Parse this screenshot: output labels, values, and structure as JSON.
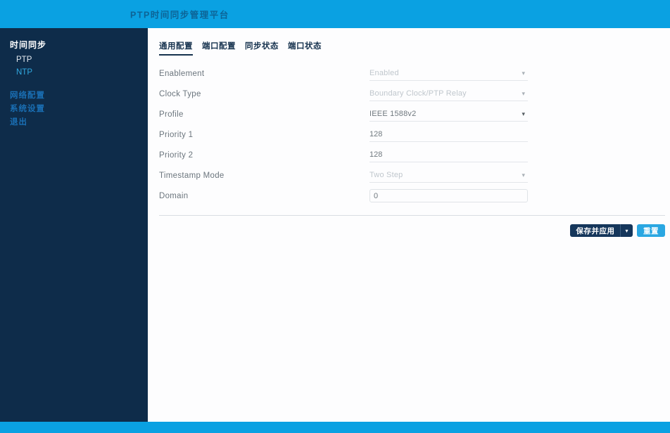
{
  "app": {
    "title": "PTP时间同步管理平台"
  },
  "colors": {
    "header_cyan": "#0aa1e2",
    "sidebar_navy": "#0e2c4a",
    "accent_cyan": "#2aa7e2",
    "button_navy": "#15365b",
    "link_blue": "#1a6fb4"
  },
  "icons": {
    "caret": "▾"
  },
  "sidebar": {
    "section_label": "时间同步",
    "items": [
      {
        "label": "PTP"
      },
      {
        "label": "NTP"
      }
    ],
    "links": [
      {
        "label": "网络配置"
      },
      {
        "label": "系统设置"
      },
      {
        "label": "退出"
      }
    ]
  },
  "tabs": [
    {
      "label": "通用配置",
      "active": true
    },
    {
      "label": "端口配置",
      "active": false
    },
    {
      "label": "同步状态",
      "active": false
    },
    {
      "label": "端口状态",
      "active": false
    }
  ],
  "form": {
    "fields": [
      {
        "label": "Enablement",
        "value": "Enabled",
        "control": "select",
        "disabled": true
      },
      {
        "label": "Clock Type",
        "value": "Boundary Clock/PTP Relay",
        "control": "select",
        "disabled": true
      },
      {
        "label": "Profile",
        "value": "IEEE 1588v2",
        "control": "select",
        "disabled": false
      },
      {
        "label": "Priority 1",
        "value": "128",
        "control": "input",
        "disabled": false
      },
      {
        "label": "Priority 2",
        "value": "128",
        "control": "input",
        "disabled": false
      },
      {
        "label": "Timestamp Mode",
        "value": "Two Step",
        "control": "select",
        "disabled": true
      },
      {
        "label": "Domain",
        "value": "0",
        "control": "input",
        "disabled": false
      }
    ]
  },
  "actions": {
    "save_label": "保存并应用",
    "reset_label": "重置"
  }
}
